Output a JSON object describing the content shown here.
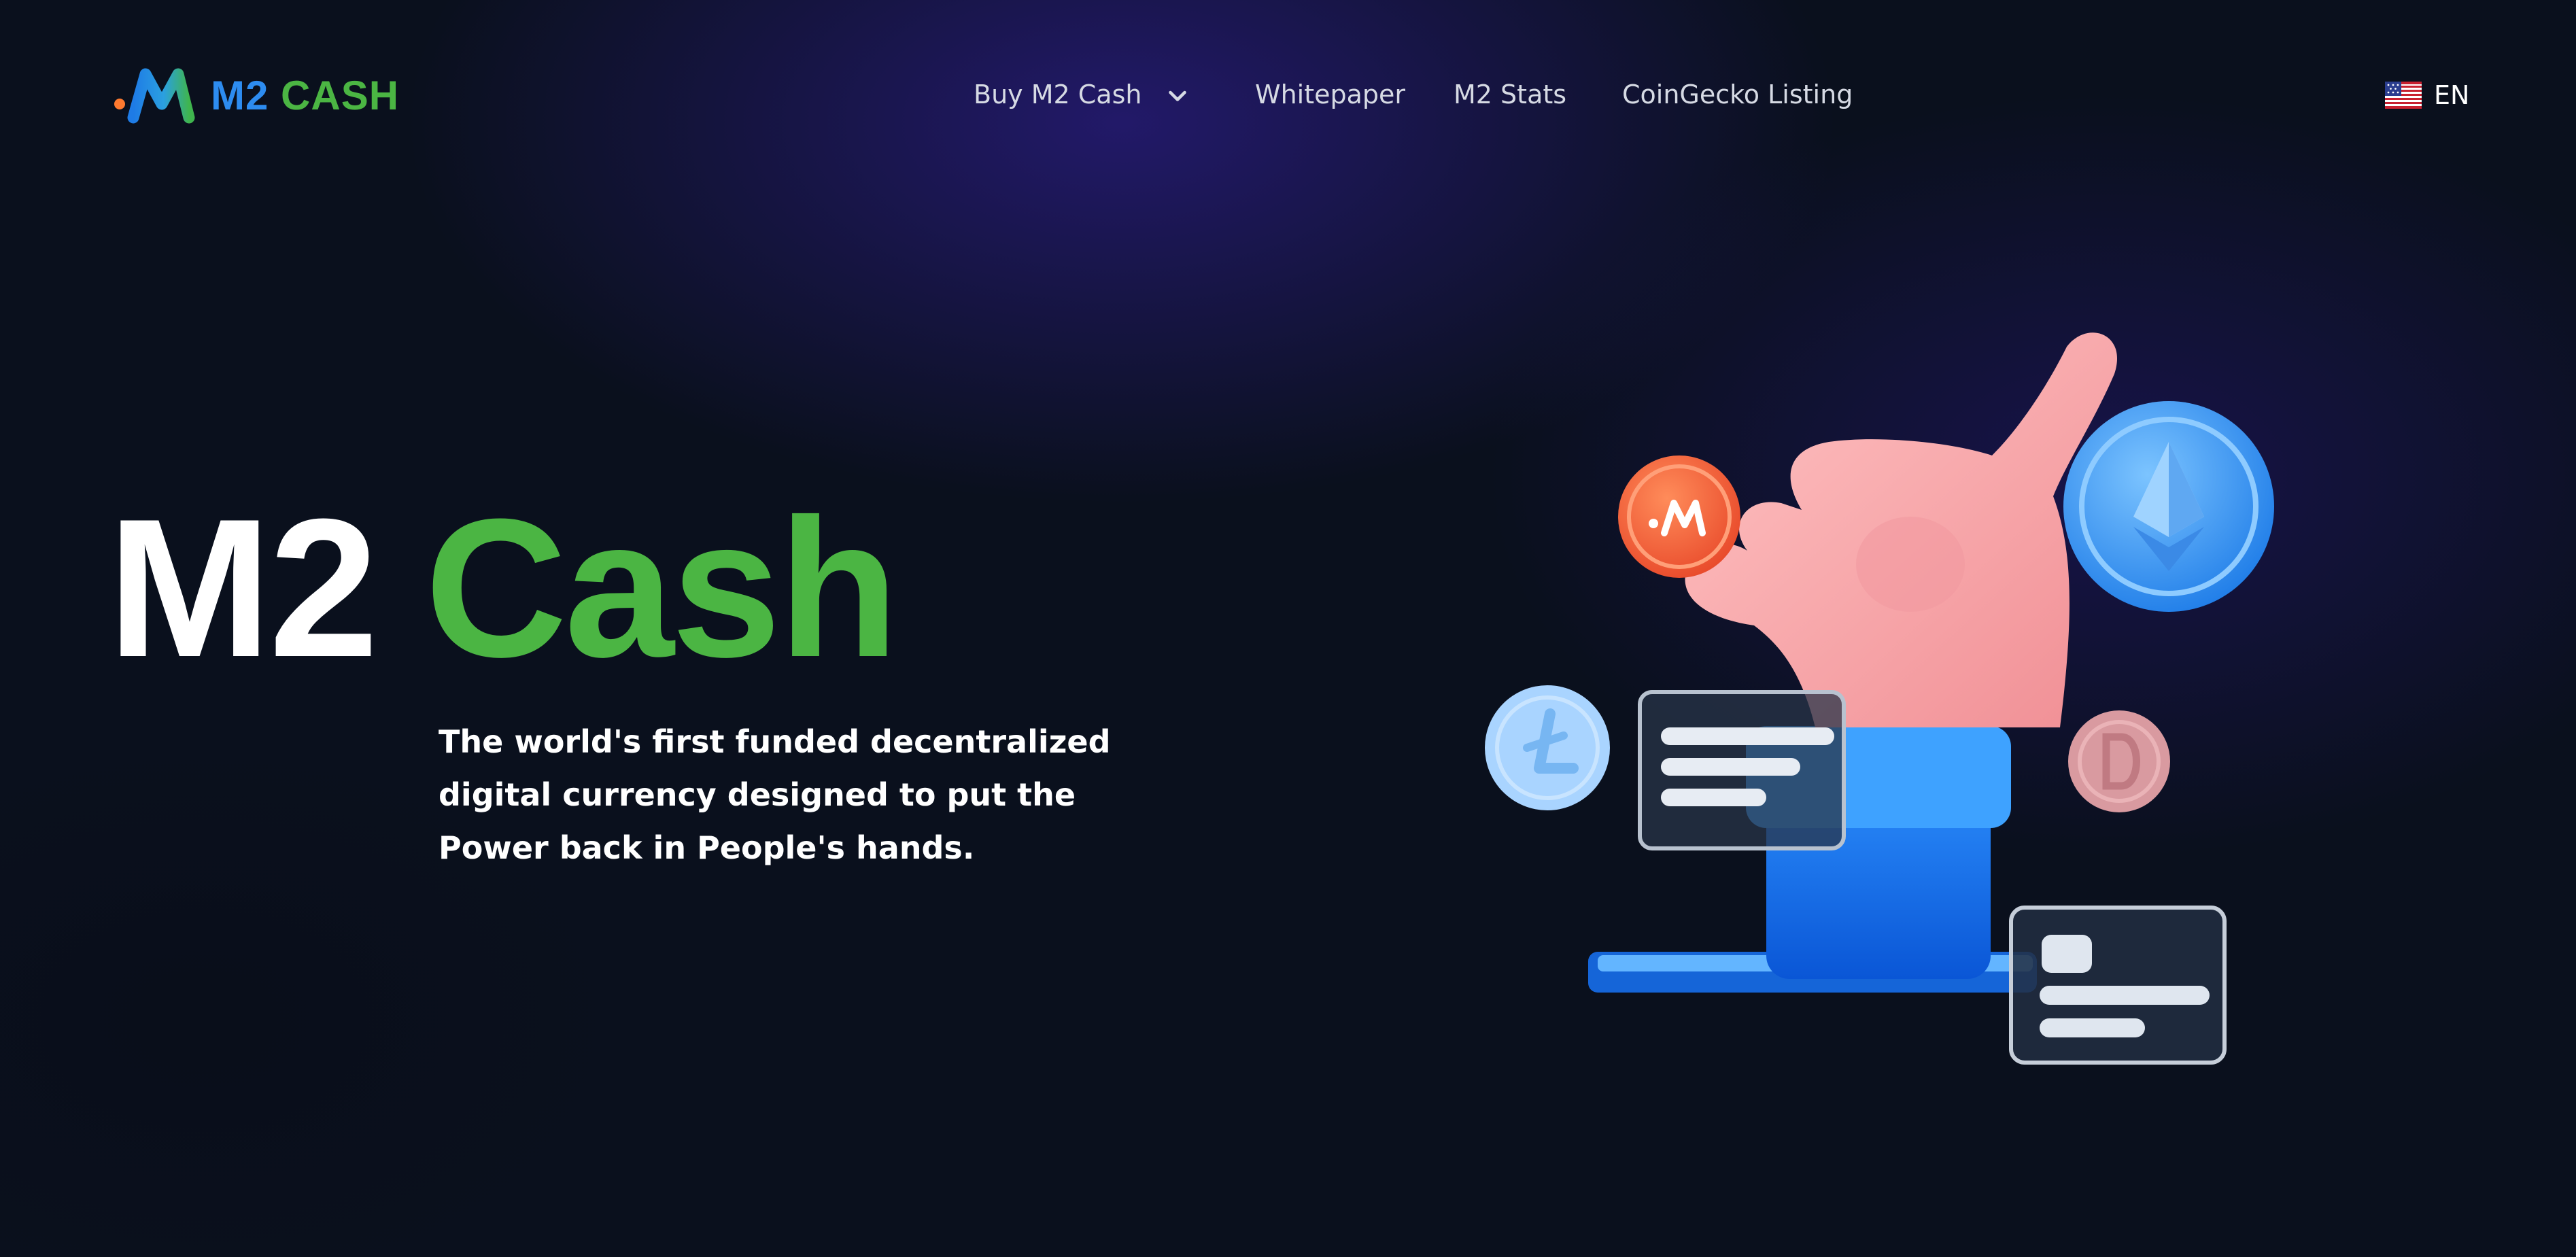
{
  "header": {
    "logo_text_m2": "M2",
    "logo_text_cash": "CASH",
    "nav": {
      "buy_label": "Buy M2 Cash",
      "whitepaper_label": "Whitepaper",
      "stats_label": "M2 Stats",
      "coingecko_label": "CoinGecko Listing"
    },
    "language": "EN"
  },
  "hero": {
    "title_white": "M2",
    "title_green": "Cash",
    "subtitle": "The world's first funded decentralized digital currency designed to put the Power back in People's hands."
  },
  "icons": {
    "logo": "m2-cash-logo-icon",
    "dropdown": "chevron-down-icon",
    "flag": "us-flag-icon",
    "illustration": "hand-holding-coin-illustration"
  },
  "colors": {
    "background": "#0a101d",
    "accent_green": "#4bb543",
    "accent_blue": "#2d8cf0",
    "nav_text": "#d6dae4",
    "coin_orange": "#ff6a3d"
  }
}
